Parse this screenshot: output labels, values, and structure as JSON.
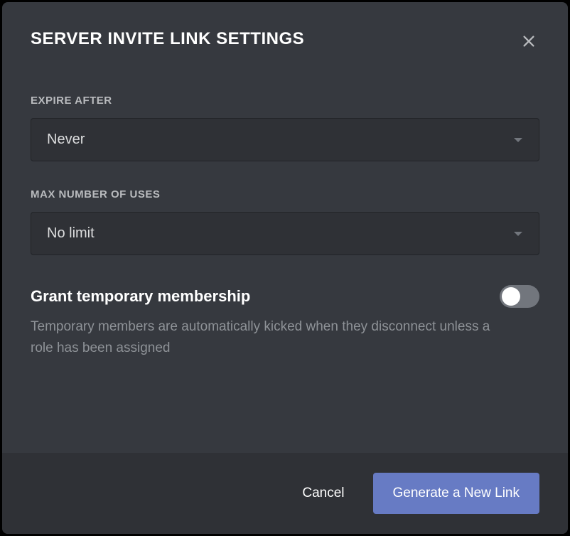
{
  "modal": {
    "title": "Server Invite Link Settings"
  },
  "expire": {
    "label": "Expire After",
    "value": "Never"
  },
  "maxUses": {
    "label": "Max Number of Uses",
    "value": "No limit"
  },
  "tempMembership": {
    "title": "Grant temporary membership",
    "description": "Temporary members are automatically kicked when they disconnect unless a role has been assigned",
    "enabled": false
  },
  "footer": {
    "cancel": "Cancel",
    "generate": "Generate a New Link"
  }
}
